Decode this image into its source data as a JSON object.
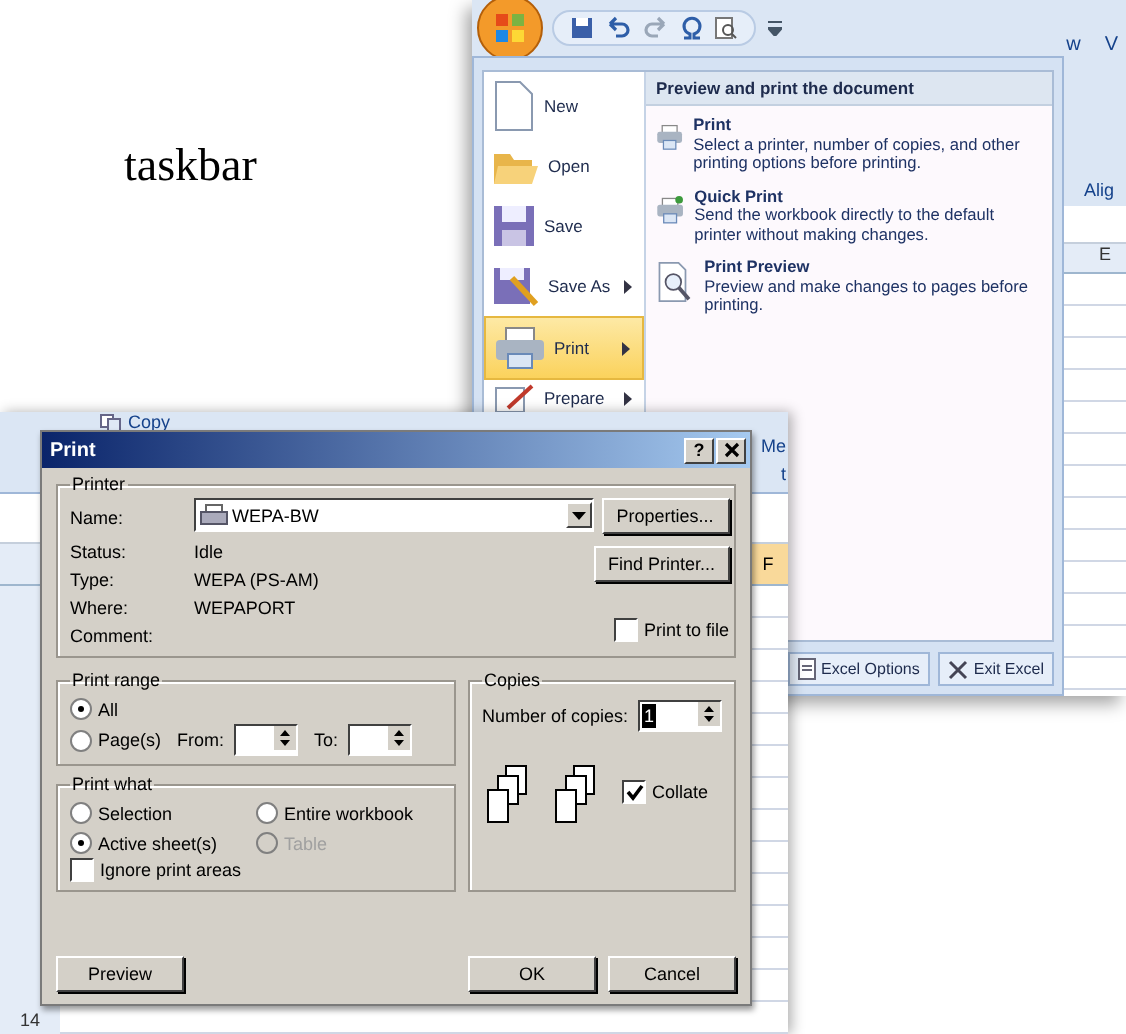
{
  "caption": "taskbar",
  "excel_window": {
    "ribbon_fragments": [
      "w",
      "V"
    ],
    "group_fragment": "Alig",
    "column_header": "E",
    "menu_items": [
      {
        "label": "New",
        "kind": "new",
        "selected": false,
        "submenu": false
      },
      {
        "label": "Open",
        "kind": "open",
        "selected": false,
        "submenu": false
      },
      {
        "label": "Save",
        "kind": "save",
        "selected": false,
        "submenu": false
      },
      {
        "label": "Save As",
        "kind": "save-as",
        "selected": false,
        "submenu": true
      },
      {
        "label": "Print",
        "kind": "print",
        "selected": true,
        "submenu": true
      },
      {
        "label": "Prepare",
        "kind": "prepare",
        "selected": false,
        "submenu": true
      }
    ],
    "panel": {
      "heading": "Preview and print the document",
      "entries": [
        {
          "kind": "print",
          "title": "Print",
          "description": "Select a printer, number of copies, and other printing options before printing."
        },
        {
          "kind": "quick-print",
          "title": "Quick Print",
          "description": "Send the workbook directly to the default printer without making changes."
        },
        {
          "kind": "preview",
          "title": "Print Preview",
          "description": "Preview and make changes to pages before printing."
        }
      ]
    },
    "footer_buttons": [
      {
        "kind": "options",
        "label": "Excel Options"
      },
      {
        "kind": "exit",
        "label": "Exit Excel"
      }
    ]
  },
  "back_sheet": {
    "ribbon_label": "Copy",
    "ribbon_fragments": [
      "Me",
      "t"
    ],
    "column_header": "F",
    "row_number": "14"
  },
  "print_dialog": {
    "title": "Print",
    "help_button": "?",
    "printer": {
      "legend": "Printer",
      "name_label": "Name:",
      "name_value": "WEPA-BW",
      "details": [
        {
          "label": "Status:",
          "value": "Idle"
        },
        {
          "label": "Type:",
          "value": "WEPA (PS-AM)"
        },
        {
          "label": "Where:",
          "value": "WEPAPORT"
        },
        {
          "label": "Comment:"
        }
      ],
      "buttons": [
        "Properties...",
        "Find Printer..."
      ],
      "print_to_file": {
        "label": "Print to file",
        "checked": false
      }
    },
    "print_range": {
      "legend": "Print range",
      "options": [
        {
          "label": "All",
          "selected": true
        },
        {
          "label": "Page(s)",
          "selected": false
        }
      ],
      "from_label": "From:",
      "to_label": "To:"
    },
    "print_what": {
      "legend": "Print what",
      "options": [
        {
          "label": "Selection",
          "selected": false,
          "disabled": false
        },
        {
          "label": "Entire workbook",
          "selected": false,
          "disabled": false
        },
        {
          "label": "Active sheet(s)",
          "selected": true,
          "disabled": false
        },
        {
          "label": "Table",
          "selected": false,
          "disabled": true
        }
      ],
      "ignore_areas": {
        "label": "Ignore print areas",
        "checked": false
      }
    },
    "copies": {
      "legend": "Copies",
      "count_label": "Number of copies:",
      "count": "1",
      "collate": {
        "label": "Collate",
        "checked": true
      }
    },
    "buttons": [
      {
        "kind": "preview",
        "label": "Preview"
      },
      {
        "kind": "ok",
        "label": "OK"
      },
      {
        "kind": "cancel",
        "label": "Cancel"
      }
    ]
  }
}
